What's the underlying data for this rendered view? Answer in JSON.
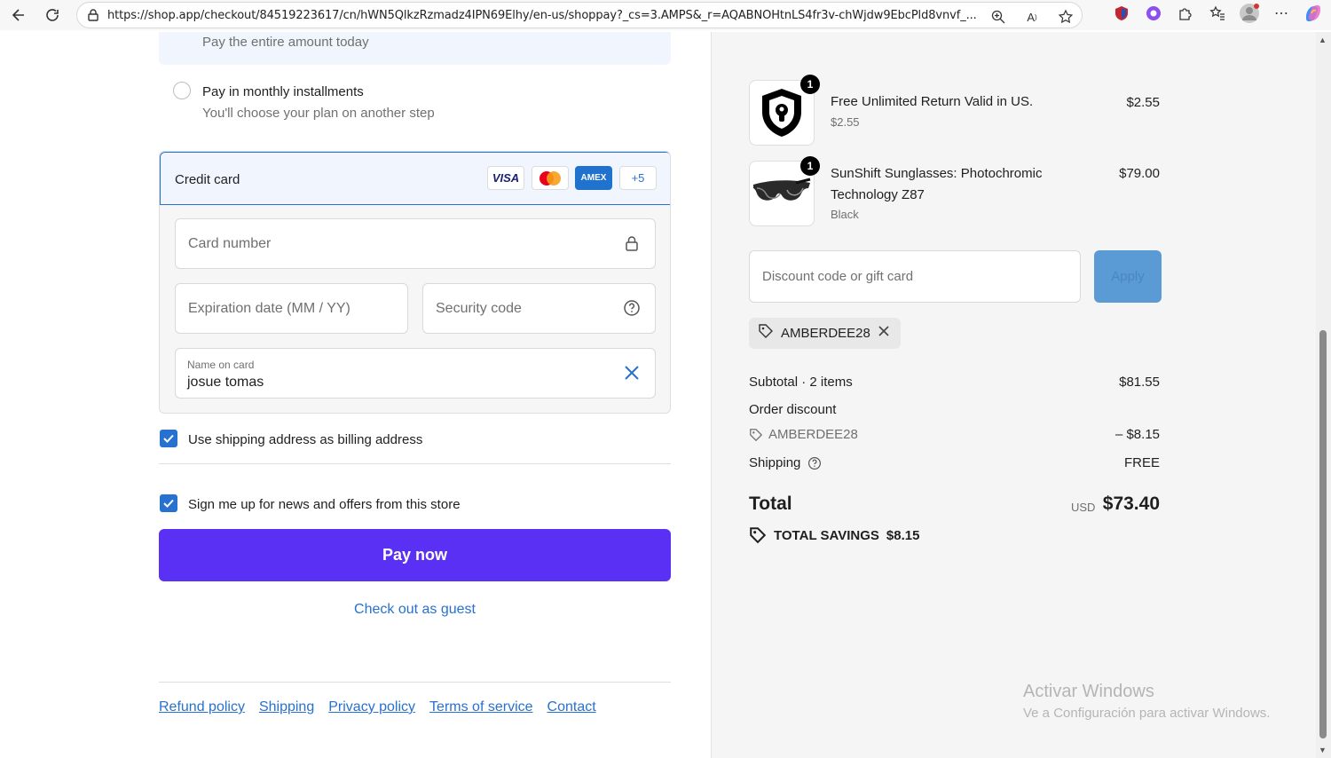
{
  "browser": {
    "url": "https://shop.app/checkout/84519223617/cn/hWN5QlkzRzmadz4IPN69Elhy/en-us/shoppay?_cs=3.AMPS&_r=AQABNOHtnLS4fr3v-chWjdw9EbcPld8vnvf_..."
  },
  "payment": {
    "pay_full_sub": "Pay the entire amount today",
    "monthly_title": "Pay in monthly installments",
    "monthly_sub": "You'll choose your plan on another step",
    "credit_card_label": "Credit card",
    "card_logos": [
      "VISA",
      "MC",
      "AMEX",
      "+5"
    ],
    "card_number_placeholder": "Card number",
    "expiration_placeholder": "Expiration date (MM / YY)",
    "security_placeholder": "Security code",
    "name_label": "Name on card",
    "name_value": "josue tomas"
  },
  "options": {
    "billing_label": "Use shipping address as billing address",
    "news_label": "Sign me up for news and offers from this store"
  },
  "actions": {
    "pay_now": "Pay now",
    "guest": "Check out as guest"
  },
  "footer": {
    "links": [
      "Refund policy",
      "Shipping",
      "Privacy policy",
      "Terms of service",
      "Contact"
    ]
  },
  "summary": {
    "items": [
      {
        "name": "Free Unlimited Return Valid in US.",
        "sub": "$2.55",
        "price": "$2.55",
        "qty": "1"
      },
      {
        "name": "SunShift Sunglasses: Photochromic Technology Z87",
        "sub": "Black",
        "price": "$79.00",
        "qty": "1"
      }
    ],
    "discount_placeholder": "Discount code or gift card",
    "apply_label": "Apply",
    "applied_code": "AMBERDEE28",
    "subtotal_label": "Subtotal · 2 items",
    "subtotal_value": "$81.55",
    "order_discount_label": "Order discount",
    "order_discount_code": "AMBERDEE28",
    "order_discount_value": "– $8.15",
    "shipping_label": "Shipping",
    "shipping_value": "FREE",
    "total_label": "Total",
    "total_currency": "USD",
    "total_value": "$73.40",
    "savings_label": "TOTAL SAVINGS",
    "savings_value": "$8.15"
  },
  "watermark": {
    "line1": "Activar Windows",
    "line2": "Ve a Configuración para activar Windows."
  },
  "colors": {
    "accent": "#2771d0",
    "pay_button": "#5a31f4",
    "summary_bg": "#f5f5f5"
  }
}
